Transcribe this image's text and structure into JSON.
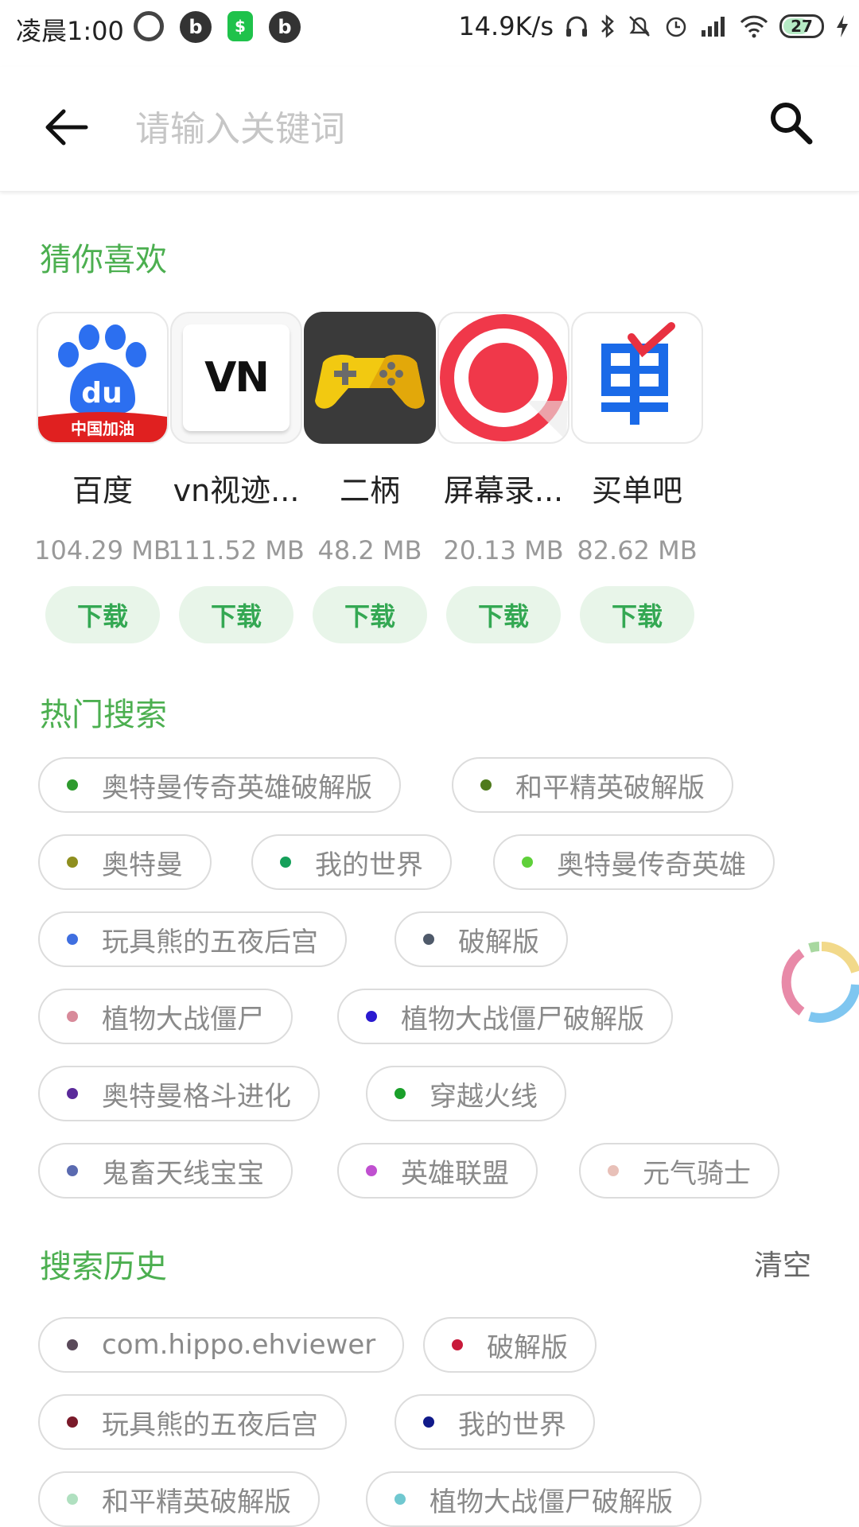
{
  "status_bar": {
    "time": "凌晨1:00",
    "network_speed": "14.9K/s",
    "battery": "27",
    "left_icons": [
      "netease-music-icon",
      "bilibili-icon",
      "shop-icon",
      "bilibili-icon"
    ],
    "right_icons": [
      "headphones-icon",
      "bluetooth-icon",
      "mute-icon",
      "alarm-icon",
      "signal-icon",
      "wifi-icon",
      "battery-icon",
      "charging-icon"
    ]
  },
  "search": {
    "placeholder": "请输入关键词",
    "value": ""
  },
  "sections": {
    "guess": "猜你喜欢",
    "hot": "热门搜索",
    "history": "搜索历史",
    "clear": "清空"
  },
  "apps": [
    {
      "name": "百度",
      "size": "104.29 MB",
      "button": "下载",
      "icon": "baidu-icon",
      "badge": "中国加油"
    },
    {
      "name": "vn视迹...",
      "size": "111.52 MB",
      "button": "下载",
      "icon": "vn-icon",
      "badge": "VN"
    },
    {
      "name": "二柄",
      "size": "48.2 MB",
      "button": "下载",
      "icon": "gamepad-icon"
    },
    {
      "name": "屏幕录...",
      "size": "20.13 MB",
      "button": "下载",
      "icon": "record-icon"
    },
    {
      "name": "买单吧",
      "size": "82.62 MB",
      "button": "下载",
      "icon": "maidanba-icon"
    }
  ],
  "hot_tags": [
    {
      "label": "奥特曼传奇英雄破解版",
      "color": "#2e9a2e"
    },
    {
      "label": "和平精英破解版",
      "color": "#4f7a1d"
    },
    {
      "label": "奥特曼",
      "color": "#8f8f1f"
    },
    {
      "label": "我的世界",
      "color": "#15a05a"
    },
    {
      "label": "奥特曼传奇英雄",
      "color": "#5fd03a"
    },
    {
      "label": "玩具熊的五夜后宫",
      "color": "#3f6fe0"
    },
    {
      "label": "破解版",
      "color": "#4f5a6a"
    },
    {
      "label": "植物大战僵尸",
      "color": "#d88a9a"
    },
    {
      "label": "植物大战僵尸破解版",
      "color": "#2a1ad0"
    },
    {
      "label": "奥特曼格斗进化",
      "color": "#5a2a9a"
    },
    {
      "label": "穿越火线",
      "color": "#1aa02a"
    },
    {
      "label": "鬼畜天线宝宝",
      "color": "#5a6ab0"
    },
    {
      "label": "英雄联盟",
      "color": "#c050d0"
    },
    {
      "label": "元气骑士",
      "color": "#e8c0b8"
    }
  ],
  "history_tags": [
    {
      "label": "com.hippo.ehviewer",
      "color": "#5a4a5a"
    },
    {
      "label": "破解版",
      "color": "#c81a3a"
    },
    {
      "label": "玩具熊的五夜后宫",
      "color": "#7a1a2a"
    },
    {
      "label": "我的世界",
      "color": "#101a8a"
    },
    {
      "label": "和平精英破解版",
      "color": "#b0e0c0"
    },
    {
      "label": "植物大战僵尸破解版",
      "color": "#70c8d0"
    }
  ]
}
